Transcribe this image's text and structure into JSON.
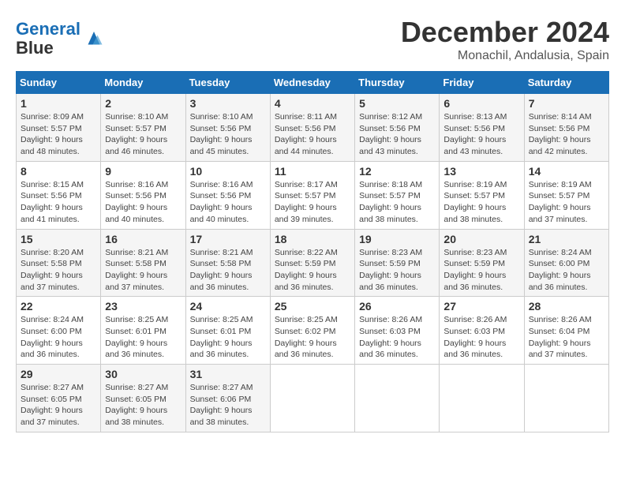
{
  "logo": {
    "line1": "General",
    "line2": "Blue"
  },
  "title": "December 2024",
  "subtitle": "Monachil, Andalusia, Spain",
  "header": {
    "days": [
      "Sunday",
      "Monday",
      "Tuesday",
      "Wednesday",
      "Thursday",
      "Friday",
      "Saturday"
    ]
  },
  "weeks": [
    [
      {
        "day": "1",
        "sunrise": "8:09 AM",
        "sunset": "5:57 PM",
        "daylight": "9 hours and 48 minutes."
      },
      {
        "day": "2",
        "sunrise": "8:10 AM",
        "sunset": "5:57 PM",
        "daylight": "9 hours and 46 minutes."
      },
      {
        "day": "3",
        "sunrise": "8:10 AM",
        "sunset": "5:56 PM",
        "daylight": "9 hours and 45 minutes."
      },
      {
        "day": "4",
        "sunrise": "8:11 AM",
        "sunset": "5:56 PM",
        "daylight": "9 hours and 44 minutes."
      },
      {
        "day": "5",
        "sunrise": "8:12 AM",
        "sunset": "5:56 PM",
        "daylight": "9 hours and 43 minutes."
      },
      {
        "day": "6",
        "sunrise": "8:13 AM",
        "sunset": "5:56 PM",
        "daylight": "9 hours and 43 minutes."
      },
      {
        "day": "7",
        "sunrise": "8:14 AM",
        "sunset": "5:56 PM",
        "daylight": "9 hours and 42 minutes."
      }
    ],
    [
      {
        "day": "8",
        "sunrise": "8:15 AM",
        "sunset": "5:56 PM",
        "daylight": "9 hours and 41 minutes."
      },
      {
        "day": "9",
        "sunrise": "8:16 AM",
        "sunset": "5:56 PM",
        "daylight": "9 hours and 40 minutes."
      },
      {
        "day": "10",
        "sunrise": "8:16 AM",
        "sunset": "5:56 PM",
        "daylight": "9 hours and 40 minutes."
      },
      {
        "day": "11",
        "sunrise": "8:17 AM",
        "sunset": "5:57 PM",
        "daylight": "9 hours and 39 minutes."
      },
      {
        "day": "12",
        "sunrise": "8:18 AM",
        "sunset": "5:57 PM",
        "daylight": "9 hours and 38 minutes."
      },
      {
        "day": "13",
        "sunrise": "8:19 AM",
        "sunset": "5:57 PM",
        "daylight": "9 hours and 38 minutes."
      },
      {
        "day": "14",
        "sunrise": "8:19 AM",
        "sunset": "5:57 PM",
        "daylight": "9 hours and 37 minutes."
      }
    ],
    [
      {
        "day": "15",
        "sunrise": "8:20 AM",
        "sunset": "5:58 PM",
        "daylight": "9 hours and 37 minutes."
      },
      {
        "day": "16",
        "sunrise": "8:21 AM",
        "sunset": "5:58 PM",
        "daylight": "9 hours and 37 minutes."
      },
      {
        "day": "17",
        "sunrise": "8:21 AM",
        "sunset": "5:58 PM",
        "daylight": "9 hours and 36 minutes."
      },
      {
        "day": "18",
        "sunrise": "8:22 AM",
        "sunset": "5:59 PM",
        "daylight": "9 hours and 36 minutes."
      },
      {
        "day": "19",
        "sunrise": "8:23 AM",
        "sunset": "5:59 PM",
        "daylight": "9 hours and 36 minutes."
      },
      {
        "day": "20",
        "sunrise": "8:23 AM",
        "sunset": "5:59 PM",
        "daylight": "9 hours and 36 minutes."
      },
      {
        "day": "21",
        "sunrise": "8:24 AM",
        "sunset": "6:00 PM",
        "daylight": "9 hours and 36 minutes."
      }
    ],
    [
      {
        "day": "22",
        "sunrise": "8:24 AM",
        "sunset": "6:00 PM",
        "daylight": "9 hours and 36 minutes."
      },
      {
        "day": "23",
        "sunrise": "8:25 AM",
        "sunset": "6:01 PM",
        "daylight": "9 hours and 36 minutes."
      },
      {
        "day": "24",
        "sunrise": "8:25 AM",
        "sunset": "6:01 PM",
        "daylight": "9 hours and 36 minutes."
      },
      {
        "day": "25",
        "sunrise": "8:25 AM",
        "sunset": "6:02 PM",
        "daylight": "9 hours and 36 minutes."
      },
      {
        "day": "26",
        "sunrise": "8:26 AM",
        "sunset": "6:03 PM",
        "daylight": "9 hours and 36 minutes."
      },
      {
        "day": "27",
        "sunrise": "8:26 AM",
        "sunset": "6:03 PM",
        "daylight": "9 hours and 36 minutes."
      },
      {
        "day": "28",
        "sunrise": "8:26 AM",
        "sunset": "6:04 PM",
        "daylight": "9 hours and 37 minutes."
      }
    ],
    [
      {
        "day": "29",
        "sunrise": "8:27 AM",
        "sunset": "6:05 PM",
        "daylight": "9 hours and 37 minutes."
      },
      {
        "day": "30",
        "sunrise": "8:27 AM",
        "sunset": "6:05 PM",
        "daylight": "9 hours and 38 minutes."
      },
      {
        "day": "31",
        "sunrise": "8:27 AM",
        "sunset": "6:06 PM",
        "daylight": "9 hours and 38 minutes."
      },
      null,
      null,
      null,
      null
    ]
  ]
}
